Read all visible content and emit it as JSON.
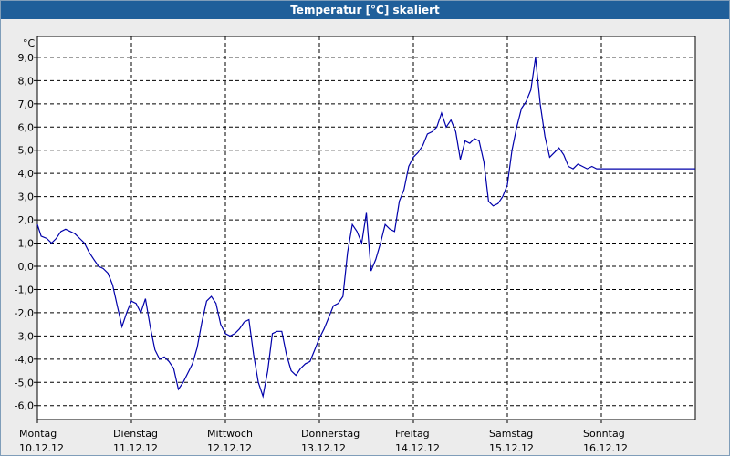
{
  "window": {
    "title": "Temperatur [°C] skaliert"
  },
  "chart_data": {
    "type": "line",
    "title": "Temperatur [°C] skaliert",
    "ylabel": "°C",
    "ylim": [
      -6.6,
      9.9
    ],
    "yticks": [
      "9,0",
      "8,0",
      "7,0",
      "6,0",
      "5,0",
      "4,0",
      "3,0",
      "2,0",
      "1,0",
      "0,0",
      "-1,0",
      "-2,0",
      "-3,0",
      "-4,0",
      "-5,0",
      "-6,0"
    ],
    "ytick_values": [
      9,
      8,
      7,
      6,
      5,
      4,
      3,
      2,
      1,
      0,
      -1,
      -2,
      -3,
      -4,
      -5,
      -6
    ],
    "xlim": [
      0,
      7
    ],
    "days": [
      {
        "name": "Montag",
        "date": "10.12.12"
      },
      {
        "name": "Dienstag",
        "date": "11.12.12"
      },
      {
        "name": "Mittwoch",
        "date": "12.12.12"
      },
      {
        "name": "Donnerstag",
        "date": "13.12.12"
      },
      {
        "name": "Freitag",
        "date": "14.12.12"
      },
      {
        "name": "Samstag",
        "date": "15.12.12"
      },
      {
        "name": "Sonntag",
        "date": "16.12.12"
      }
    ],
    "grid": true,
    "line_color": "#0000aa",
    "series": [
      {
        "x": [
          0,
          0.04,
          0.1,
          0.15,
          0.2,
          0.25,
          0.3,
          0.35,
          0.4,
          0.45,
          0.5,
          0.55,
          0.6,
          0.65,
          0.7,
          0.75,
          0.8,
          0.85,
          0.9,
          0.95,
          1.0,
          1.05,
          1.1,
          1.15,
          1.2,
          1.25,
          1.3,
          1.35,
          1.4,
          1.45,
          1.5,
          1.55,
          1.6,
          1.65,
          1.7,
          1.75,
          1.8,
          1.85,
          1.9,
          1.95,
          2.0,
          2.05,
          2.1,
          2.15,
          2.2,
          2.25,
          2.3,
          2.35,
          2.4,
          2.45,
          2.5,
          2.55,
          2.6,
          2.65,
          2.7,
          2.75,
          2.8,
          2.85,
          2.9,
          2.95,
          3.0,
          3.05,
          3.1,
          3.15,
          3.2,
          3.25,
          3.3,
          3.35,
          3.4,
          3.45,
          3.5,
          3.55,
          3.6,
          3.65,
          3.7,
          3.75,
          3.8,
          3.85,
          3.9,
          3.95,
          4.0,
          4.05,
          4.1,
          4.15,
          4.2,
          4.25,
          4.3,
          4.35,
          4.4,
          4.45,
          4.5,
          4.55,
          4.6,
          4.65,
          4.7,
          4.75,
          4.8,
          4.85,
          4.9,
          4.95,
          5.0,
          5.05,
          5.1,
          5.15,
          5.2,
          5.25,
          5.3,
          5.35,
          5.4,
          5.45,
          5.5,
          5.55,
          5.6,
          5.65,
          5.7,
          5.75,
          5.8,
          5.85,
          5.9,
          5.95,
          6.0,
          6.05,
          6.1,
          6.15,
          6.2,
          6.25,
          6.3,
          6.35,
          6.4,
          6.45,
          6.5,
          6.55,
          6.6,
          6.65,
          6.7,
          6.75,
          6.8,
          6.85,
          6.9,
          6.95,
          7.0
        ],
        "y": [
          1.8,
          1.3,
          1.2,
          1.0,
          1.2,
          1.5,
          1.6,
          1.5,
          1.4,
          1.2,
          1.0,
          0.6,
          0.3,
          0.0,
          -0.1,
          -0.3,
          -0.8,
          -1.7,
          -2.6,
          -2.0,
          -1.5,
          -1.6,
          -2.0,
          -1.4,
          -2.6,
          -3.6,
          -4.0,
          -3.9,
          -4.1,
          -4.4,
          -5.3,
          -5.0,
          -4.6,
          -4.2,
          -3.5,
          -2.4,
          -1.5,
          -1.3,
          -1.6,
          -2.5,
          -2.9,
          -3.0,
          -2.9,
          -2.7,
          -2.4,
          -2.3,
          -3.8,
          -5.0,
          -5.6,
          -4.5,
          -2.9,
          -2.8,
          -2.8,
          -3.8,
          -4.5,
          -4.7,
          -4.4,
          -4.2,
          -4.1,
          -3.6,
          -3.1,
          -2.7,
          -2.2,
          -1.7,
          -1.6,
          -1.3,
          0.6,
          1.8,
          1.5,
          1.0,
          2.3,
          -0.2,
          0.3,
          1.0,
          1.8,
          1.6,
          1.5,
          2.8,
          3.3,
          4.3,
          4.7,
          4.9,
          5.2,
          5.7,
          5.8,
          6.0,
          6.6,
          6.0,
          6.3,
          5.8,
          4.6,
          5.4,
          5.3,
          5.5,
          5.4,
          4.5,
          2.8,
          2.6,
          2.7,
          3.0,
          3.5,
          5.0,
          6.0,
          6.8,
          7.1,
          7.6,
          9.0,
          7.0,
          5.6,
          4.7,
          4.9,
          5.1,
          4.8,
          4.3,
          4.2,
          4.4,
          4.3,
          4.2,
          4.3,
          4.2,
          4.2,
          4.2,
          4.2,
          4.2,
          4.2,
          4.2,
          4.2,
          4.2,
          4.2,
          4.2,
          4.2,
          4.2,
          4.2,
          4.2,
          4.2,
          4.2,
          4.2,
          4.2,
          4.2,
          4.2,
          4.2
        ]
      }
    ]
  }
}
